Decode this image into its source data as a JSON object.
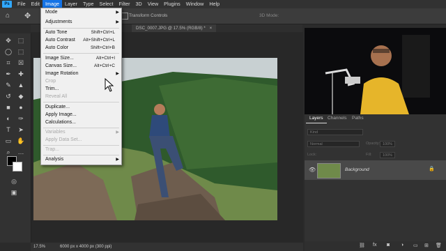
{
  "menubar": {
    "logo": "Ps",
    "items": [
      "File",
      "Edit",
      "Image",
      "Layer",
      "Type",
      "Select",
      "Filter",
      "3D",
      "View",
      "Plugins",
      "Window",
      "Help"
    ],
    "active_index": 2
  },
  "optionsbar": {
    "transform_label": "Transform Controls",
    "mode_label": "3D Mode:"
  },
  "tabs": [
    {
      "label": "DSC_0007.JPG @ 17.5% (RGB/8) *",
      "close": "×"
    }
  ],
  "image_menu": {
    "items": [
      {
        "label": "Mode",
        "shortcut": "",
        "submenu": true,
        "disabled": false
      },
      {
        "label": "Adjustments",
        "shortcut": "",
        "submenu": true,
        "disabled": false
      },
      {
        "label": "Auto Tone",
        "shortcut": "Shift+Ctrl+L",
        "submenu": false,
        "disabled": false
      },
      {
        "label": "Auto Contrast",
        "shortcut": "Alt+Shift+Ctrl+L",
        "submenu": false,
        "disabled": false
      },
      {
        "label": "Auto Color",
        "shortcut": "Shift+Ctrl+B",
        "submenu": false,
        "disabled": false
      },
      {
        "label": "Image Size...",
        "shortcut": "Alt+Ctrl+I",
        "submenu": false,
        "disabled": false
      },
      {
        "label": "Canvas Size...",
        "shortcut": "Alt+Ctrl+C",
        "submenu": false,
        "disabled": false
      },
      {
        "label": "Image Rotation",
        "shortcut": "",
        "submenu": true,
        "disabled": false
      },
      {
        "label": "Crop",
        "shortcut": "",
        "submenu": false,
        "disabled": true
      },
      {
        "label": "Trim...",
        "shortcut": "",
        "submenu": false,
        "disabled": false
      },
      {
        "label": "Reveal All",
        "shortcut": "",
        "submenu": false,
        "disabled": true
      },
      {
        "label": "Duplicate...",
        "shortcut": "",
        "submenu": false,
        "disabled": false
      },
      {
        "label": "Apply Image...",
        "shortcut": "",
        "submenu": false,
        "disabled": false
      },
      {
        "label": "Calculations...",
        "shortcut": "",
        "submenu": false,
        "disabled": false
      },
      {
        "label": "Variables",
        "shortcut": "",
        "submenu": true,
        "disabled": true
      },
      {
        "label": "Apply Data Set...",
        "shortcut": "",
        "submenu": false,
        "disabled": true
      },
      {
        "label": "Trap...",
        "shortcut": "",
        "submenu": false,
        "disabled": true
      },
      {
        "label": "Analysis",
        "shortcut": "",
        "submenu": true,
        "disabled": false
      }
    ]
  },
  "status": {
    "zoom": "17.5%",
    "doc_info": "6000 px x 4000 px (300 ppi)"
  },
  "layers_panel": {
    "tabs": [
      "Layers",
      "Channels",
      "Paths"
    ],
    "kind_label": "Kind",
    "blend_mode": "Normal",
    "opacity_label": "Opacity:",
    "opacity_value": "100%",
    "lock_label": "Lock:",
    "fill_label": "Fill:",
    "fill_value": "100%",
    "layer_name": "Background"
  },
  "colors": {
    "accent": "#1473e6",
    "menu_bg": "#f0f0f0",
    "panel_bg": "#323232"
  }
}
